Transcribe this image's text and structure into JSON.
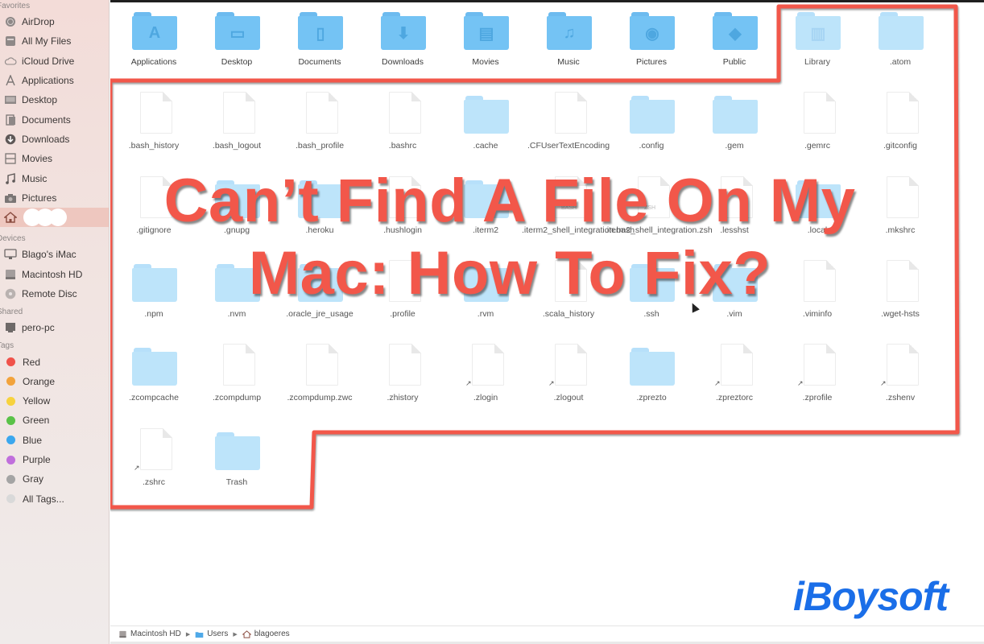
{
  "sidebar": {
    "sections": {
      "favorites": "Favorites",
      "devices": "Devices",
      "shared": "Shared",
      "tags": "Tags"
    },
    "favorites": [
      {
        "label": "AirDrop",
        "icon": "airdrop-icon"
      },
      {
        "label": "All My Files",
        "icon": "all-files-icon"
      },
      {
        "label": "iCloud Drive",
        "icon": "cloud-icon"
      },
      {
        "label": "Applications",
        "icon": "applications-icon"
      },
      {
        "label": "Desktop",
        "icon": "desktop-icon"
      },
      {
        "label": "Documents",
        "icon": "documents-icon"
      },
      {
        "label": "Downloads",
        "icon": "downloads-icon"
      },
      {
        "label": "Movies",
        "icon": "movies-icon"
      },
      {
        "label": "Music",
        "icon": "music-icon"
      },
      {
        "label": "Pictures",
        "icon": "pictures-icon"
      }
    ],
    "home_item": {
      "label": "",
      "icon": "home-icon",
      "redacted": true
    },
    "devices": [
      {
        "label": "Blago's iMac",
        "icon": "imac-icon"
      },
      {
        "label": "Macintosh HD",
        "icon": "harddisk-icon"
      },
      {
        "label": "Remote Disc",
        "icon": "disc-icon"
      }
    ],
    "shared": [
      {
        "label": "pero-pc",
        "icon": "pc-icon"
      }
    ],
    "tags": [
      {
        "label": "Red",
        "color": "#f0524a"
      },
      {
        "label": "Orange",
        "color": "#f2a33b"
      },
      {
        "label": "Yellow",
        "color": "#f7d23e"
      },
      {
        "label": "Green",
        "color": "#5ac248"
      },
      {
        "label": "Blue",
        "color": "#3ba7ee"
      },
      {
        "label": "Purple",
        "color": "#c06fdc"
      },
      {
        "label": "Gray",
        "color": "#a4a4a4"
      },
      {
        "label": "All Tags...",
        "color": "#d9d9d9"
      }
    ]
  },
  "files": [
    {
      "name": "Applications",
      "type": "folder",
      "glyph": "A",
      "hidden": false
    },
    {
      "name": "Desktop",
      "type": "folder",
      "glyph": "▭",
      "hidden": false
    },
    {
      "name": "Documents",
      "type": "folder",
      "glyph": "▯",
      "hidden": false
    },
    {
      "name": "Downloads",
      "type": "folder",
      "glyph": "⬇",
      "hidden": false
    },
    {
      "name": "Movies",
      "type": "folder",
      "glyph": "▤",
      "hidden": false
    },
    {
      "name": "Music",
      "type": "folder",
      "glyph": "♫",
      "hidden": false
    },
    {
      "name": "Pictures",
      "type": "folder",
      "glyph": "◉",
      "hidden": false
    },
    {
      "name": "Public",
      "type": "folder",
      "glyph": "◆",
      "hidden": false
    },
    {
      "name": "Library",
      "type": "folder",
      "glyph": "▥",
      "hidden": true
    },
    {
      "name": ".atom",
      "type": "folder",
      "glyph": "",
      "hidden": true
    },
    {
      "name": ".bash_history",
      "type": "file",
      "hidden": true
    },
    {
      "name": ".bash_logout",
      "type": "file",
      "hidden": true
    },
    {
      "name": ".bash_profile",
      "type": "file",
      "hidden": true
    },
    {
      "name": ".bashrc",
      "type": "file",
      "hidden": true
    },
    {
      "name": ".cache",
      "type": "folder",
      "glyph": "",
      "hidden": true
    },
    {
      "name": ".CFUserTextEncoding",
      "type": "file",
      "hidden": true
    },
    {
      "name": ".config",
      "type": "folder",
      "glyph": "",
      "hidden": true
    },
    {
      "name": ".gem",
      "type": "folder",
      "glyph": "",
      "hidden": true
    },
    {
      "name": ".gemrc",
      "type": "file",
      "hidden": true
    },
    {
      "name": ".gitconfig",
      "type": "file",
      "hidden": true
    },
    {
      "name": ".gitignore",
      "type": "file",
      "hidden": true
    },
    {
      "name": ".gnupg",
      "type": "folder",
      "glyph": "",
      "hidden": true
    },
    {
      "name": ".heroku",
      "type": "folder",
      "glyph": "",
      "hidden": true
    },
    {
      "name": ".hushlogin",
      "type": "file",
      "hidden": true
    },
    {
      "name": ".iterm2",
      "type": "folder",
      "glyph": "",
      "hidden": true
    },
    {
      "name": ".iterm2_shell_integration.bash",
      "type": "file",
      "badge": "BASH",
      "hidden": true
    },
    {
      "name": ".iterm2_shell_integration.zsh",
      "type": "file",
      "badge": "ZSH",
      "hidden": true
    },
    {
      "name": ".lesshst",
      "type": "file",
      "hidden": true
    },
    {
      "name": ".local",
      "type": "folder",
      "glyph": "",
      "hidden": true
    },
    {
      "name": ".mkshrc",
      "type": "file",
      "hidden": true
    },
    {
      "name": ".npm",
      "type": "folder",
      "glyph": "",
      "hidden": true
    },
    {
      "name": ".nvm",
      "type": "folder",
      "glyph": "",
      "hidden": true
    },
    {
      "name": ".oracle_jre_usage",
      "type": "folder",
      "glyph": "",
      "hidden": true
    },
    {
      "name": ".profile",
      "type": "file",
      "hidden": true
    },
    {
      "name": ".rvm",
      "type": "folder",
      "glyph": "",
      "hidden": true
    },
    {
      "name": ".scala_history",
      "type": "file",
      "hidden": true
    },
    {
      "name": ".ssh",
      "type": "folder",
      "glyph": "",
      "hidden": true
    },
    {
      "name": ".vim",
      "type": "folder",
      "glyph": "",
      "hidden": true
    },
    {
      "name": ".viminfo",
      "type": "file",
      "hidden": true
    },
    {
      "name": ".wget-hsts",
      "type": "file",
      "hidden": true
    },
    {
      "name": ".zcompcache",
      "type": "folder",
      "glyph": "",
      "hidden": true
    },
    {
      "name": ".zcompdump",
      "type": "file",
      "hidden": true
    },
    {
      "name": ".zcompdump.zwc",
      "type": "file",
      "hidden": true
    },
    {
      "name": ".zhistory",
      "type": "file",
      "hidden": true
    },
    {
      "name": ".zlogin",
      "type": "alias",
      "hidden": true
    },
    {
      "name": ".zlogout",
      "type": "alias",
      "hidden": true
    },
    {
      "name": ".zprezto",
      "type": "folder",
      "glyph": "",
      "hidden": true
    },
    {
      "name": ".zpreztorc",
      "type": "alias",
      "hidden": true
    },
    {
      "name": ".zprofile",
      "type": "alias",
      "hidden": true
    },
    {
      "name": ".zshenv",
      "type": "alias",
      "hidden": true
    },
    {
      "name": ".zshrc",
      "type": "alias",
      "hidden": true
    },
    {
      "name": "Trash",
      "type": "folder",
      "glyph": "",
      "hidden": true
    }
  ],
  "overlay": {
    "headline_line1": "Can’t Find A File On My",
    "headline_line2": "Mac: How To Fix?",
    "highlight_color": "#f2574a"
  },
  "pathbar": {
    "items": [
      {
        "label": "Macintosh HD",
        "icon": "harddisk-icon"
      },
      {
        "label": "Users",
        "icon": "folder-icon"
      },
      {
        "label": "blagoeres",
        "icon": "home-icon"
      }
    ],
    "separator": "▶"
  },
  "brand": {
    "name": "iBoysoft",
    "color": "#1a6ee8"
  }
}
